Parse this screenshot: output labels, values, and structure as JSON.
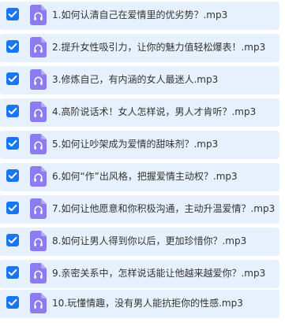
{
  "files": [
    {
      "name": "1.如何认清自己在爱情里的优劣势？.mp3",
      "checked": true,
      "icon": "audio-file-icon"
    },
    {
      "name": "2.提升女性吸引力，让你的魅力值轻松爆表！.mp3",
      "checked": true,
      "icon": "audio-file-icon"
    },
    {
      "name": "3.修炼自己，有内涵的女人最迷人.mp3",
      "checked": true,
      "icon": "audio-file-icon"
    },
    {
      "name": "4.高阶说话术！女人怎样说，男人才肯听？.mp3",
      "checked": true,
      "icon": "audio-file-icon"
    },
    {
      "name": "5.如何让吵架成为爱情的甜味剂？.mp3",
      "checked": true,
      "icon": "audio-file-icon"
    },
    {
      "name": "6.如何“作”出风格，把握爱情主动权？.mp3",
      "checked": true,
      "icon": "audio-file-icon"
    },
    {
      "name": "7.如何让他愿意和你积极沟通，主动升温爱情？.mp3",
      "checked": true,
      "icon": "audio-file-icon"
    },
    {
      "name": "8.如何让男人得到你以后，更加珍惜你？.mp3",
      "checked": true,
      "icon": "audio-file-icon"
    },
    {
      "name": "9.亲密关系中，怎样说话能让他越来越爱你？.mp3",
      "checked": true,
      "icon": "audio-file-icon"
    },
    {
      "name": "10.玩懂情趣，没有男人能抗拒你的性感.mp3",
      "checked": true,
      "icon": "audio-file-icon"
    }
  ],
  "colors": {
    "row_background": "#e7f0fd",
    "checkbox": "#1976f2",
    "file_icon": "#8c7cf0",
    "text": "#333333"
  }
}
